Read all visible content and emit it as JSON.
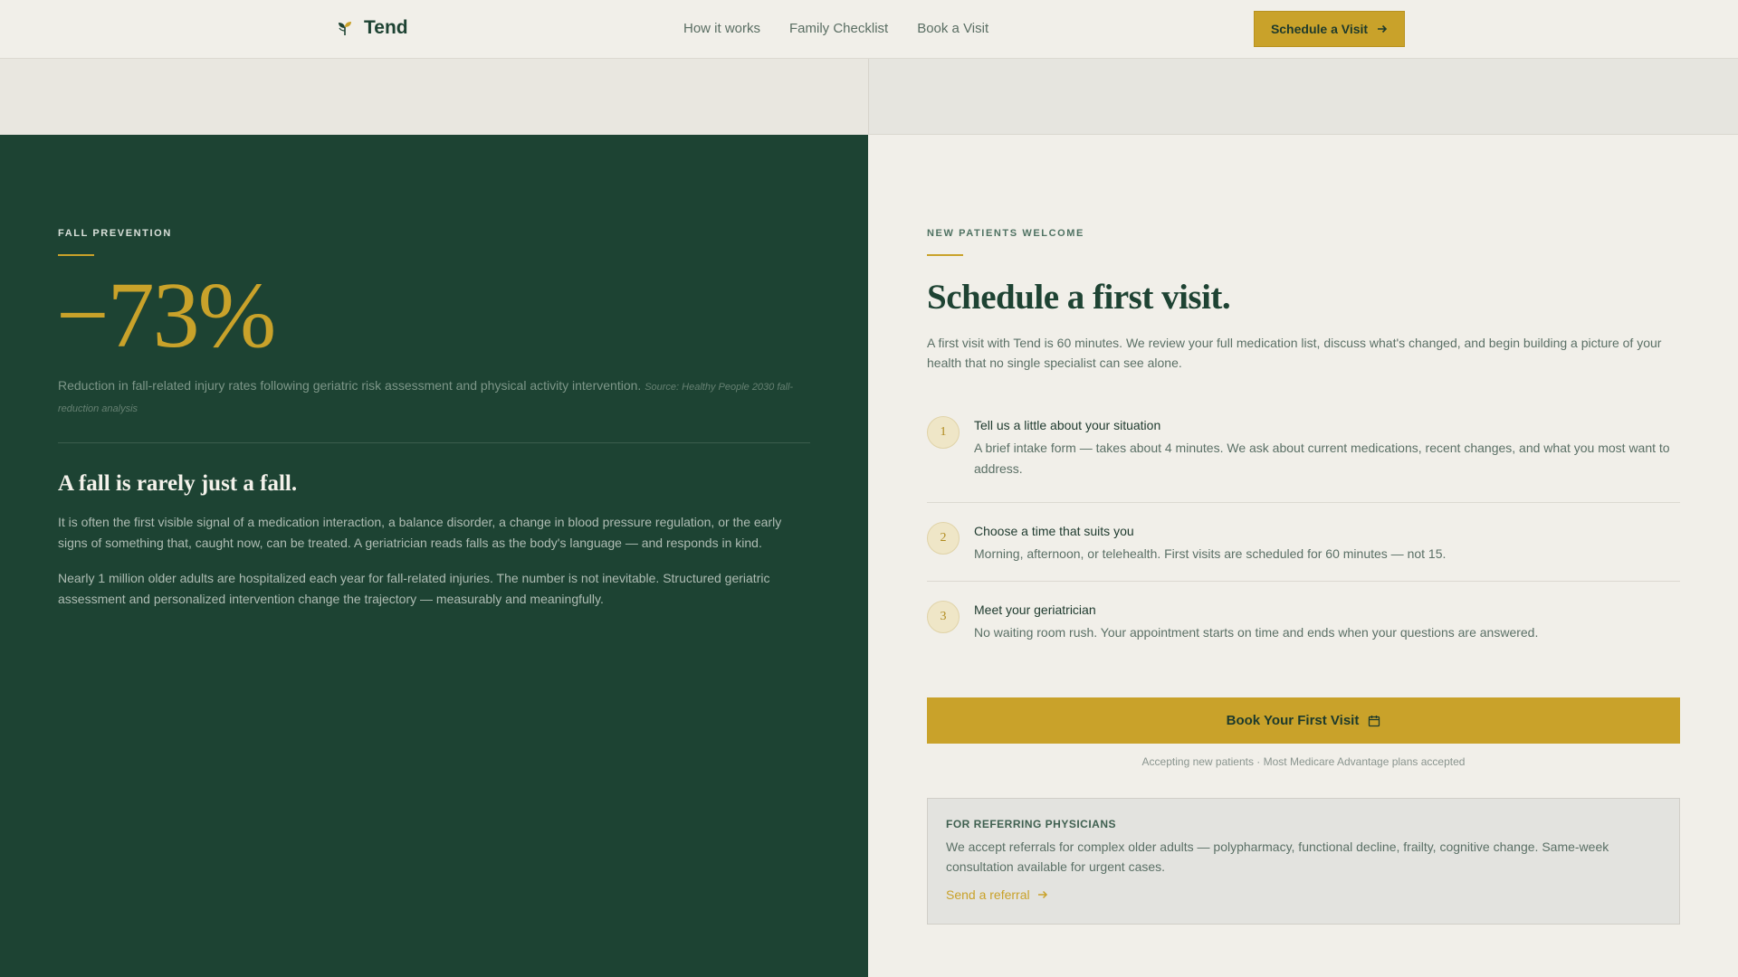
{
  "header": {
    "brand": "Tend",
    "logo_icon": "sprout-icon",
    "nav": [
      "How it works",
      "Family Checklist",
      "Book a Visit"
    ],
    "cta_label": "Schedule a Visit",
    "cta_icon": "arrow-right-icon"
  },
  "left": {
    "eyebrow": "Fall Prevention",
    "stat": "−73%",
    "stat_desc": "Reduction in fall-related injury rates following geriatric risk assessment and physical activity intervention.",
    "stat_source": "Source: Healthy People 2030 fall-reduction analysis",
    "heading": "A fall is rarely just a fall.",
    "paragraphs": [
      "It is often the first visible signal of a medication interaction, a balance disorder, a change in blood pressure regulation, or the early signs of something that, caught now, can be treated. A geriatrician reads falls as the body's language — and responds in kind.",
      "Nearly 1 million older adults are hospitalized each year for fall-related injuries. The number is not inevitable. Structured geriatric assessment and personalized intervention change the trajectory — measurably and meaningfully."
    ]
  },
  "right": {
    "eyebrow": "New Patients Welcome",
    "heading": "Schedule a first visit.",
    "intro": "A first visit with Tend is 60 minutes. We review your full medication list, discuss what's changed, and begin building a picture of your health that no single specialist can see alone.",
    "steps": [
      {
        "num": "1",
        "title": "Tell us a little about your situation",
        "desc": "A brief intake form — takes about 4 minutes. We ask about current medications, recent changes, and what you most want to address."
      },
      {
        "num": "2",
        "title": "Choose a time that suits you",
        "desc": "Morning, afternoon, or telehealth. First visits are scheduled for 60 minutes — not 15."
      },
      {
        "num": "3",
        "title": "Meet your geriatrician",
        "desc": "No waiting room rush. Your appointment starts on time and ends when your questions are answered."
      }
    ],
    "book_label": "Book Your First Visit",
    "book_icon": "calendar-icon",
    "book_note": "Accepting new patients · Most Medicare Advantage plans accepted",
    "referral": {
      "title": "For Referring Physicians",
      "text": "We accept referrals for complex older adults — polypharmacy, functional decline, frailty, cognitive change. Same-week consultation available for urgent cases.",
      "link_label": "Send a referral",
      "link_icon": "arrow-right-icon"
    }
  },
  "colors": {
    "dark_green": "#1d4333",
    "gold": "#c9a22a",
    "cream": "#f1efe9"
  }
}
